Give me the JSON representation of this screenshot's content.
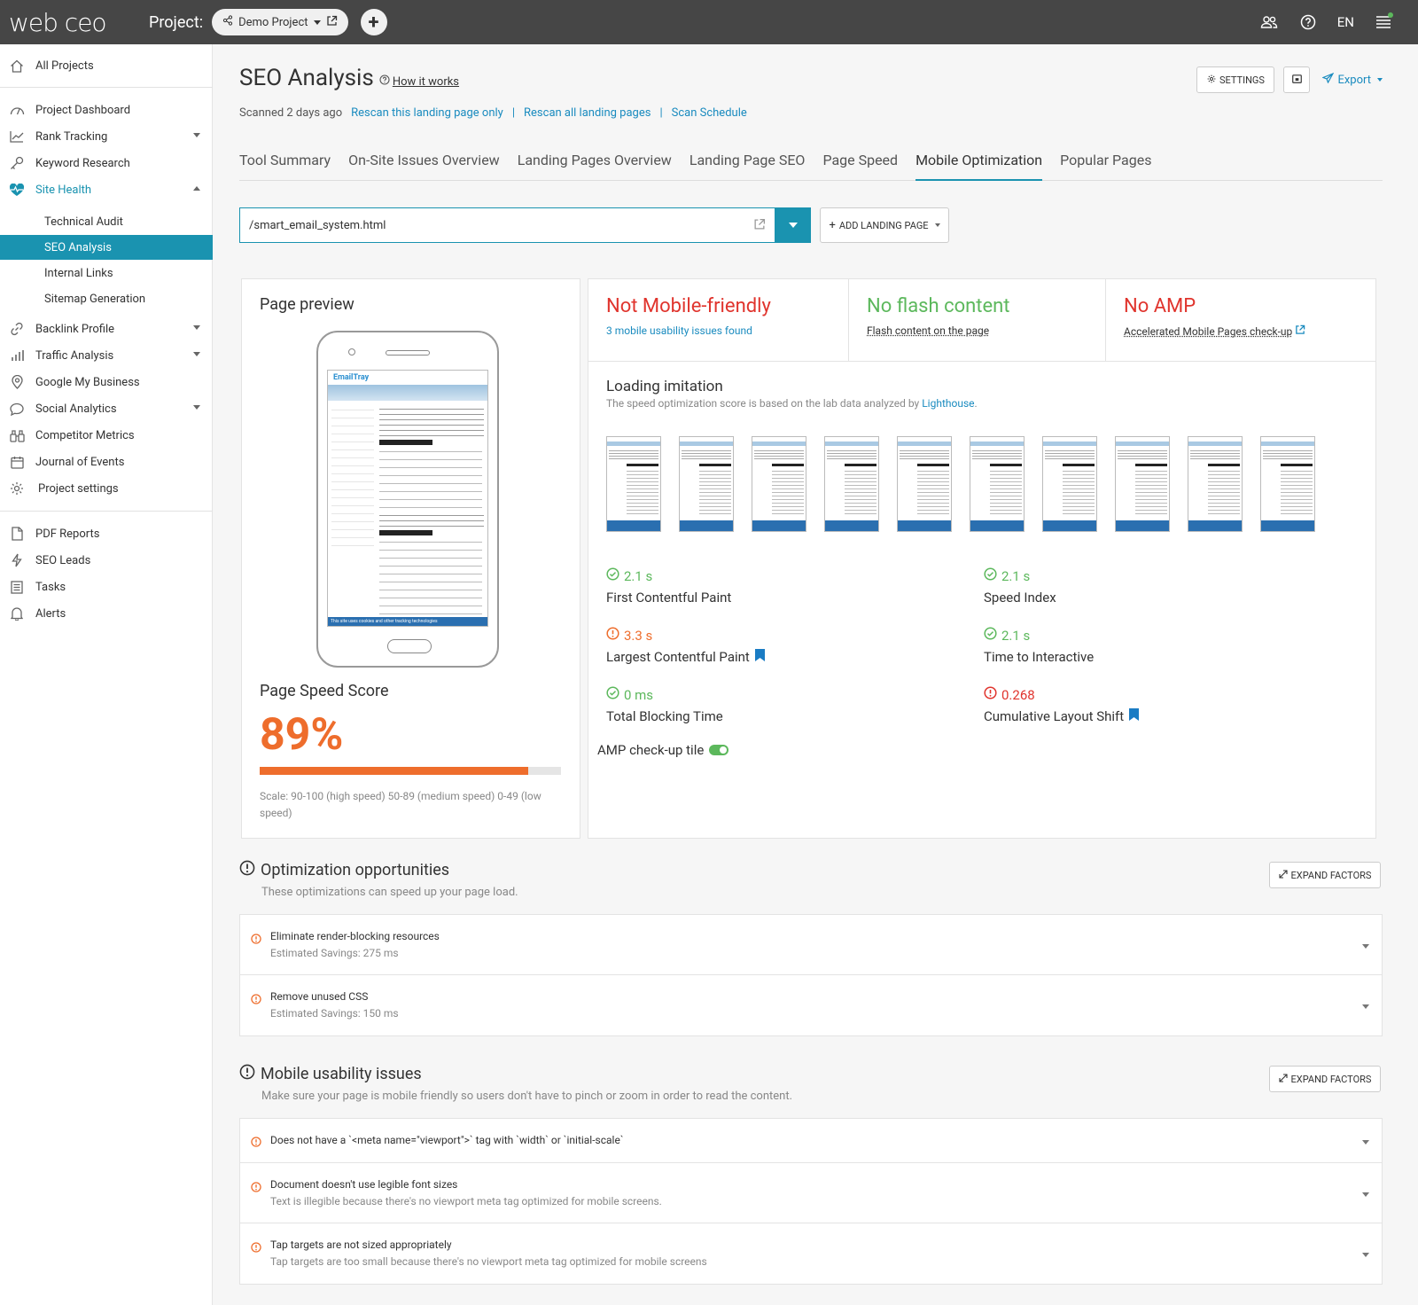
{
  "topbar": {
    "logo": "web ceo",
    "project_label": "Project:",
    "project_name": "Demo Project",
    "lang": "EN"
  },
  "sidebar": {
    "all_projects": "All Projects",
    "items": [
      "Project Dashboard",
      "Rank Tracking",
      "Keyword Research",
      "Site Health"
    ],
    "sub": [
      "Technical Audit",
      "SEO Analysis",
      "Internal Links",
      "Sitemap Generation"
    ],
    "items2": [
      "Backlink Profile",
      "Traffic Analysis",
      "Google My Business",
      "Social Analytics",
      "Competitor Metrics",
      "Journal of Events",
      "Project settings"
    ],
    "items3": [
      "PDF Reports",
      "SEO Leads",
      "Tasks",
      "Alerts"
    ]
  },
  "header": {
    "title": "SEO Analysis",
    "how": "How it works",
    "scanned": "Scanned 2 days ago",
    "rescan_one": "Rescan this landing page only",
    "rescan_all": "Rescan all landing pages",
    "schedule": "Scan Schedule",
    "settings": "SETTINGS",
    "export": "Export"
  },
  "tabs": [
    "Tool Summary",
    "On-Site Issues Overview",
    "Landing Pages Overview",
    "Landing Page SEO",
    "Page Speed",
    "Mobile Optimization",
    "Popular Pages"
  ],
  "url": "/smart_email_system.html",
  "add_lp": "ADD LANDING PAGE",
  "preview": {
    "title": "Page preview",
    "emailtray": "EmailTray",
    "footer_text": "This site uses cookies and other tracking technologies",
    "pss_title": "Page Speed Score",
    "pss_value": "89%",
    "pss_fraction": 0.89,
    "scale": "Scale: 90-100 (high speed) 50-89 (medium speed) 0-49 (low speed)"
  },
  "status": {
    "mobile": "Not Mobile-friendly",
    "mobile_sub": "3 mobile usability issues found",
    "flash": "No flash content",
    "flash_sub": "Flash content on the page",
    "amp": "No AMP",
    "amp_sub": "Accelerated Mobile Pages check-up"
  },
  "loading": {
    "title": "Loading imitation",
    "sub": "The speed optimization score is based on the lab data analyzed by",
    "sub_link": "Lighthouse",
    "sub_end": "."
  },
  "metrics": [
    {
      "value": "2.1 s",
      "name": "First Contentful Paint",
      "status": "ok"
    },
    {
      "value": "2.1 s",
      "name": "Speed Index",
      "status": "ok"
    },
    {
      "value": "3.3 s",
      "name": "Largest Contentful Paint",
      "status": "warn",
      "flag": true
    },
    {
      "value": "2.1 s",
      "name": "Time to Interactive",
      "status": "ok"
    },
    {
      "value": "0 ms",
      "name": "Total Blocking Time",
      "status": "ok"
    },
    {
      "value": "0.268",
      "name": "Cumulative Layout Shift",
      "status": "bad",
      "flag": true
    }
  ],
  "amp_tile": "AMP check-up tile",
  "opt": {
    "title": "Optimization opportunities",
    "sub": "These optimizations can speed up your page load.",
    "expand": "EXPAND FACTORS",
    "items": [
      {
        "t": "Eliminate render-blocking resources",
        "s": "Estimated Savings: 275 ms"
      },
      {
        "t": "Remove unused CSS",
        "s": "Estimated Savings: 150 ms"
      }
    ]
  },
  "mob": {
    "title": "Mobile usability issues",
    "sub": "Make sure your page is mobile friendly so users don't have to pinch or zoom in order to read the content.",
    "expand": "EXPAND FACTORS",
    "items": [
      {
        "t": "Does not have a `<meta name=\"viewport\">` tag with `width` or `initial-scale`",
        "s": ""
      },
      {
        "t": "Document doesn't use legible font sizes",
        "s": "Text is illegible because there's no viewport meta tag optimized for mobile screens."
      },
      {
        "t": "Tap targets are not sized appropriately",
        "s": "Tap targets are too small because there's no viewport meta tag optimized for mobile screens"
      }
    ]
  },
  "colors": {
    "accent": "#1a93b0",
    "orange": "#ee6d2c",
    "red": "#e0342d",
    "green": "#5cb85c"
  }
}
